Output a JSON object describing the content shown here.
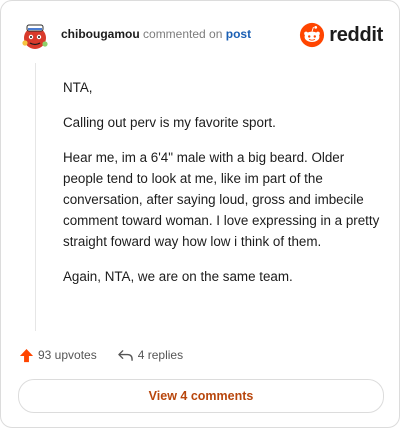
{
  "header": {
    "username": "chibougamou",
    "action_text": "commented on",
    "post_link": "post",
    "logo_text": "reddit"
  },
  "comment": {
    "paragraphs": [
      "NTA,",
      "Calling out perv is my favorite sport.",
      "Hear me, im a 6'4\" male with a big beard. Older people tend to look at me, like im part of the conversation, after saying loud, gross and imbecile comment toward woman. I love expressing in a pretty straight foward way how low i think of them.",
      "Again, NTA, we are on the same team."
    ]
  },
  "actions": {
    "upvotes": "93 upvotes",
    "replies": "4 replies"
  },
  "footer": {
    "view_comments_label": "View 4 comments"
  },
  "colors": {
    "brand": "#ff4500",
    "upvote": "#ff4500",
    "link": "#1a5fb4",
    "button_text": "#b8460c"
  },
  "icons": {
    "avatar": "snoo-avatar-icon",
    "logo": "reddit-logo-icon",
    "upvote": "upvote-arrow-icon",
    "reply": "reply-arrow-icon"
  }
}
